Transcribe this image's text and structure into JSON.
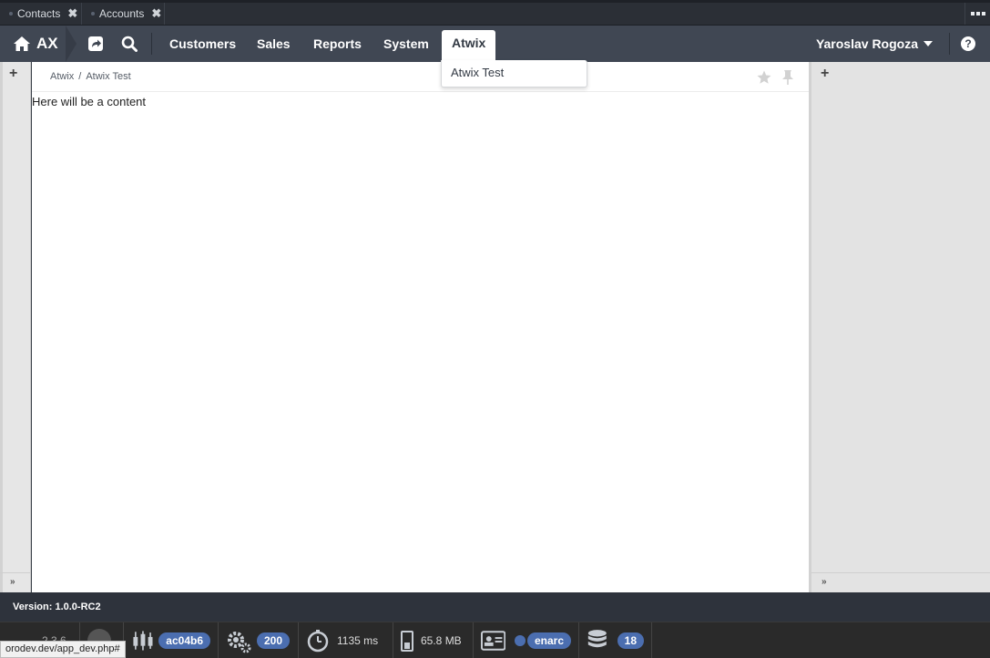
{
  "pinned_tabs": [
    {
      "label": "Contacts"
    },
    {
      "label": "Accounts"
    }
  ],
  "nav": {
    "logo_text": "AX",
    "menu": [
      "Customers",
      "Sales",
      "Reports",
      "System",
      "Atwix"
    ],
    "user_name": "Yaroslav Rogoza",
    "help": "?"
  },
  "dropdown": {
    "items": [
      "Atwix Test"
    ]
  },
  "breadcrumb": {
    "parent": "Atwix",
    "separator": "/",
    "current": "Atwix Test"
  },
  "content": {
    "text": "Here will be a content"
  },
  "rails": {
    "add_symbol": "+",
    "collapse_symbol": "»"
  },
  "footer": {
    "version": "Version: 1.0.0-RC2",
    "symfony_version": "2.3.6",
    "git_hash": "ac04b6",
    "status_code": "200",
    "time": "1135 ms",
    "memory": "65.8 MB",
    "user": "enarc",
    "db_queries": "18",
    "status_url": "orodev.dev/app_dev.php#"
  },
  "colors": {
    "nav_bg": "#404753",
    "badge": "#4b6eb0"
  }
}
